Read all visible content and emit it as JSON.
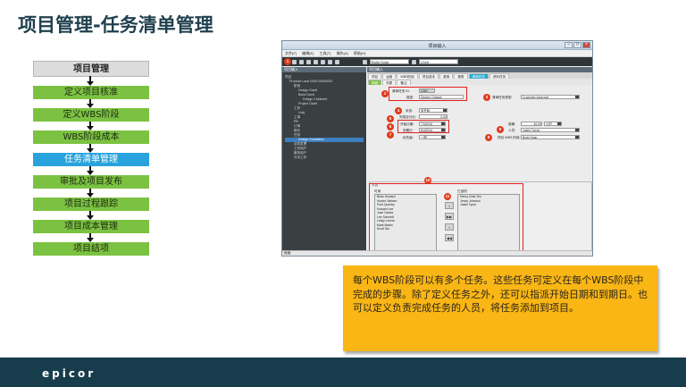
{
  "slide": {
    "title": "项目管理-任务清单管理",
    "callout": "每个WBS阶段可以有多个任务。这些任务可定义在每个WBS阶段中完成的步骤。除了定义任务之外，还可以指派开始日期和到期日。也可以定义负责完成任务的人员，将任务添加到项目。",
    "logo": "epicor"
  },
  "flow": {
    "header": "项目管理",
    "steps": [
      {
        "label": "定义项目核准",
        "active": false
      },
      {
        "label": "定义WBS阶段",
        "active": false
      },
      {
        "label": "WBS阶段成本",
        "active": false
      },
      {
        "label": "任务清单管理",
        "active": true
      },
      {
        "label": "审批及项目发布",
        "active": false
      },
      {
        "label": "项目过程跟踪",
        "active": false
      },
      {
        "label": "项目成本管理",
        "active": false
      },
      {
        "label": "项目结项",
        "active": false
      }
    ]
  },
  "app": {
    "window_title": "项目输入",
    "menu": [
      "文件(F)",
      "编辑(E)",
      "工具(T)",
      "操作(A)",
      "帮助(H)"
    ],
    "toolbar": {
      "project_value": "Build Solar",
      "id_value": "(Get)"
    },
    "tree": {
      "header": "项目输入",
      "nodes": [
        {
          "label": "项目",
          "indent": 0,
          "selected": false
        },
        {
          "label": "Produce Lane 0000.00000002",
          "indent": 1,
          "selected": false
        },
        {
          "label": "阶段",
          "indent": 2,
          "selected": false
        },
        {
          "label": "Design Gantt",
          "indent": 3,
          "selected": false
        },
        {
          "label": "Build Gantt",
          "indent": 3,
          "selected": false
        },
        {
          "label": "Design Chksheet",
          "indent": 4,
          "selected": false
        },
        {
          "label": "Project Gantt",
          "indent": 3,
          "selected": false
        },
        {
          "label": "工作",
          "indent": 2,
          "selected": false
        },
        {
          "label": "Uoly",
          "indent": 3,
          "selected": false
        },
        {
          "label": "工单",
          "indent": 2,
          "selected": false
        },
        {
          "label": "PB",
          "indent": 2,
          "selected": false
        },
        {
          "label": "订单",
          "indent": 2,
          "selected": false
        },
        {
          "label": "报价",
          "indent": 2,
          "selected": false
        },
        {
          "label": "任务",
          "indent": 2,
          "selected": false
        },
        {
          "label": "Design Gustafsen",
          "indent": 3,
          "selected": true
        },
        {
          "label": "合同发票",
          "indent": 2,
          "selected": false
        },
        {
          "label": "工作用户",
          "indent": 2,
          "selected": false
        },
        {
          "label": "服务用户",
          "indent": 2,
          "selected": false
        },
        {
          "label": "分派工作",
          "indent": 2,
          "selected": false
        }
      ]
    },
    "detail": {
      "header": "项目输入",
      "tabs": [
        "项目",
        "运用",
        "WBS阶段",
        "项目成本",
        "费用",
        "报表",
        "清单任务",
        "资料任务"
      ],
      "active_tab": "清单任务",
      "subtabs": [
        "明细",
        "列表",
        "备注"
      ],
      "active_subtab": "明细",
      "fields": {
        "task_id_label": "清单任务 ID:",
        "task_id_value": "1069",
        "desc_label": "描述:",
        "desc_value": "Design Chassis",
        "type_label": "清单任务类型:",
        "type_value": "Customer Approval",
        "status_label": "状态:",
        "status_value": "未开始",
        "complete_label": "完成百分比:",
        "complete_value": "0.00",
        "start_label": "开始日期:",
        "start_value": "7/3/2016",
        "due_label": "到期日:",
        "due_value": "8/4/2016",
        "priority_label": "优先级:",
        "priority_value": "一般",
        "duration_label": "周期:",
        "duration_value": "40.00",
        "duration_unit": "小时",
        "person_label": "人员:",
        "person_value": "Justin Tyrnst",
        "proj_label": "项目 WBS 阶段:",
        "proj_value": "Build Solar"
      },
      "people": {
        "section_label": "人员",
        "available_label": "可用",
        "selected_label": "已选项",
        "available": [
          "Brian Howard",
          "Hunter Nielsen",
          "Fred Quenby",
          "Howard Lee",
          "Jose Garcia",
          "Lee Schmidt",
          "Linsly Lemos",
          "Mark Martin",
          "Scott Tao"
        ],
        "selected": [
          "Henry Grist-Teo",
          "Jenny Johnson",
          "Justin Tyner"
        ],
        "movers": [
          ">",
          "▶▶",
          "<",
          "◀◀"
        ]
      }
    },
    "status": "就绪",
    "badges": [
      "1",
      "2",
      "3",
      "4",
      "5",
      "6",
      "7",
      "8",
      "9",
      "10",
      "11"
    ]
  },
  "colors": {
    "title": "#1f3f4d",
    "flow_green": "#7cc242",
    "flow_active": "#29a3dd",
    "callout": "#f9b614",
    "footer": "#173d4c",
    "badge": "#e03a1c"
  }
}
